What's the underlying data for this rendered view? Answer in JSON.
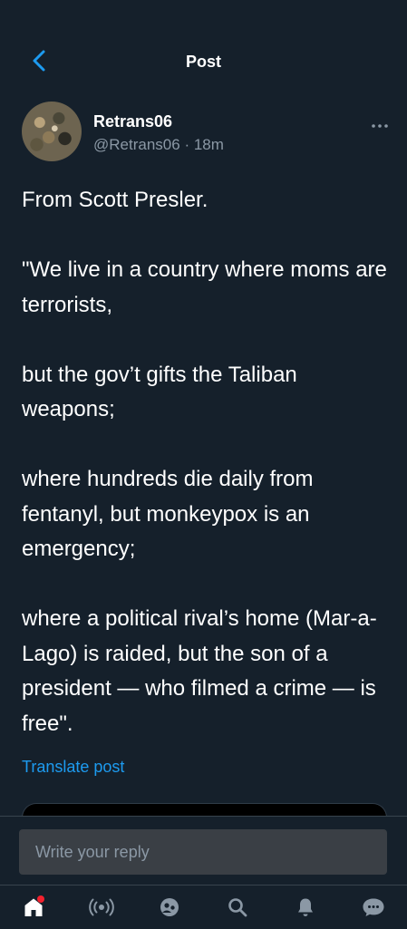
{
  "header": {
    "title": "Post"
  },
  "author": {
    "display_name": "Retrans06",
    "handle": "@Retrans06",
    "separator": "·",
    "time": "18m"
  },
  "post": {
    "text": "From Scott Presler.\n\n\"We live in a country where moms are terrorists,\n\nbut the gov’t gifts the Taliban weapons;\n\nwhere hundreds die daily from fentanyl, but monkeypox is an emergency;\n\nwhere a political rival’s home (Mar-a-Lago) is raided, but the son of a president — who filmed a crime — is free\".",
    "translate_label": "Translate post"
  },
  "reply": {
    "placeholder": "Write your reply"
  },
  "bottom_nav": {
    "items": [
      "home-icon",
      "spaces-icon",
      "communities-icon",
      "search-icon",
      "notifications-icon",
      "messages-icon"
    ],
    "home_has_notification": true
  },
  "colors": {
    "background": "#15202b",
    "accent": "#1d9bf0",
    "muted": "#8b98a5",
    "notification": "#f4212e"
  }
}
